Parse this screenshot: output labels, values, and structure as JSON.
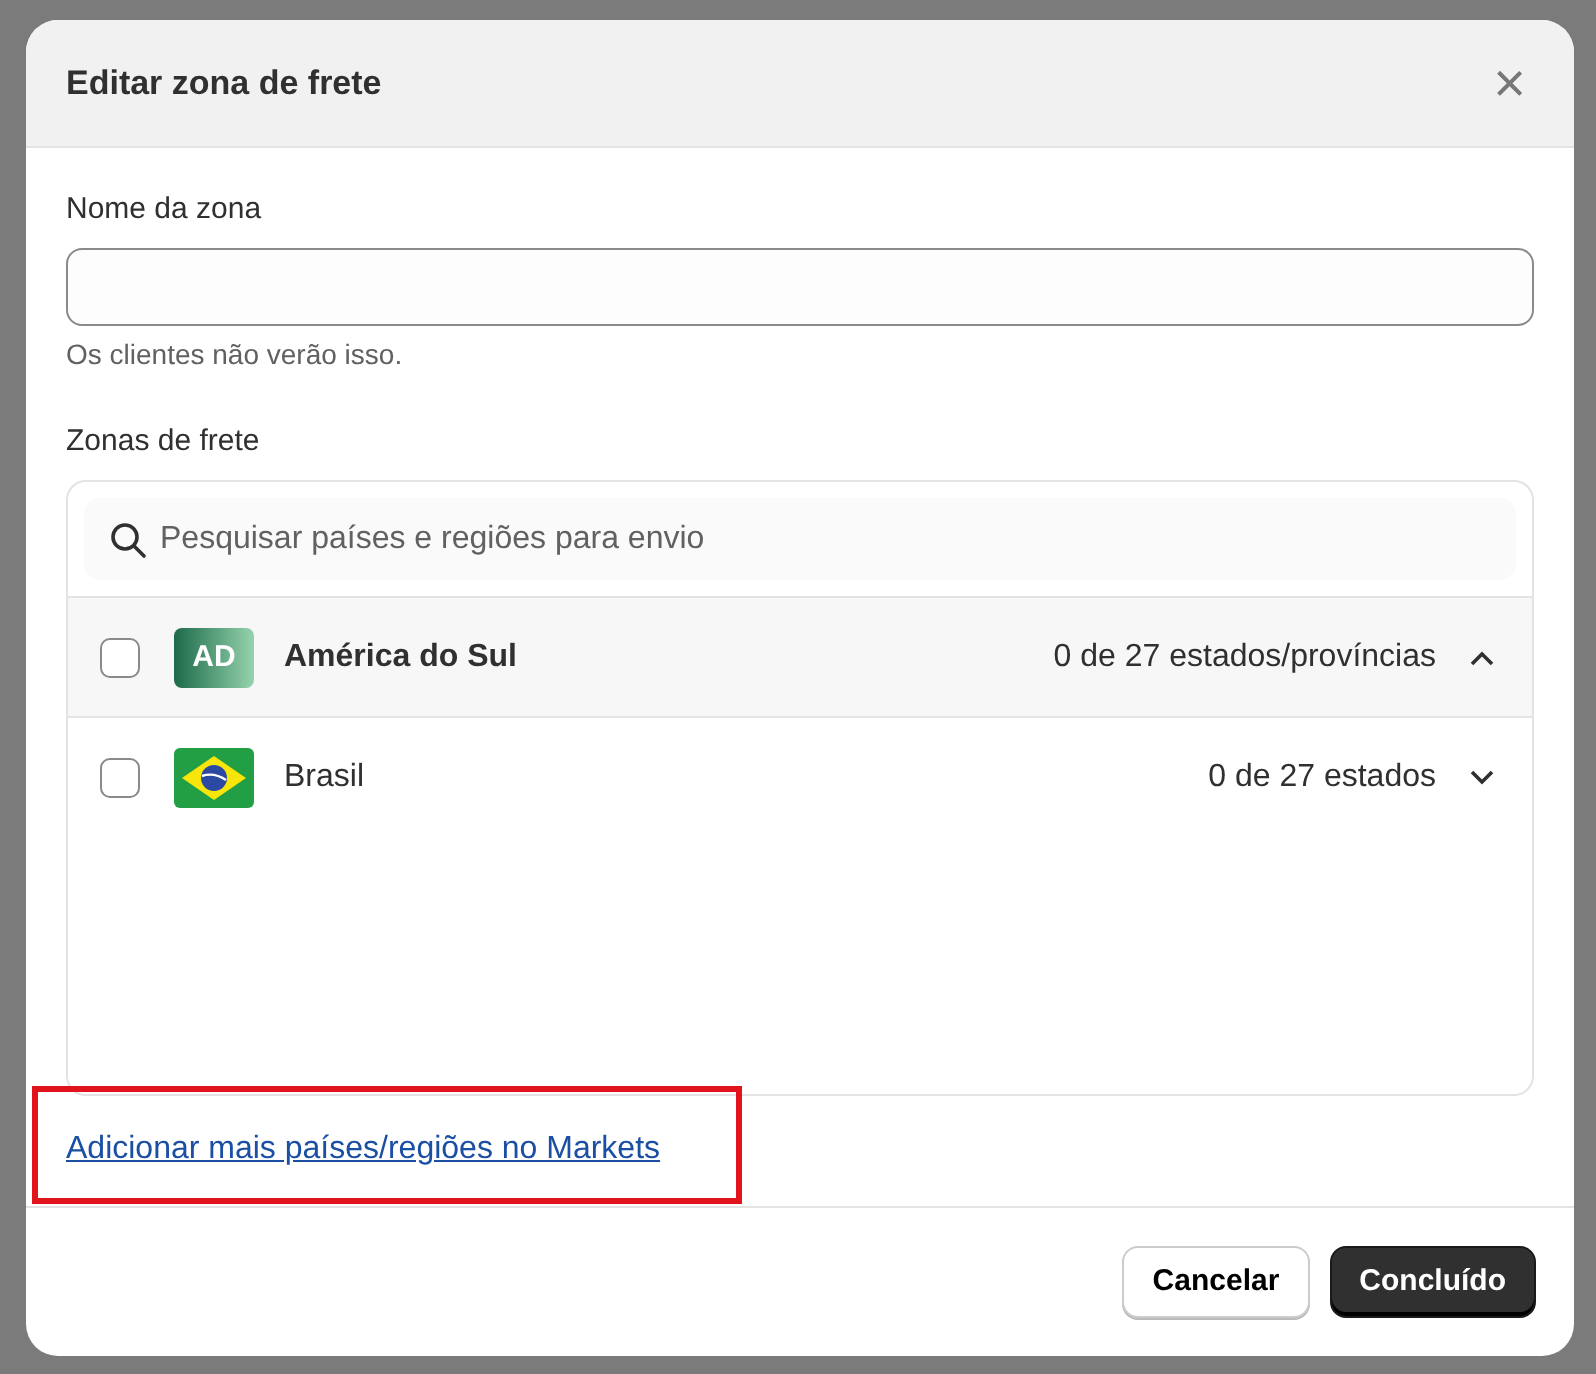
{
  "dialog": {
    "title": "Editar zona de frete",
    "close_label": "×"
  },
  "zone_name": {
    "label": "Nome da zona",
    "help": "Os clientes não verão isso."
  },
  "zones": {
    "label": "Zonas de frete",
    "search": {
      "placeholder": "Pesquisar países e regiões para envio"
    },
    "rows": [
      {
        "kind": "region",
        "badge": "AD",
        "name": "América do Sul",
        "count": "0 de 27 estados/províncias",
        "checked": false,
        "expanded": true
      },
      {
        "kind": "country",
        "name": "Brasil",
        "count": "0 de 27 estados",
        "checked": false,
        "expanded": false
      }
    ]
  },
  "link": {
    "text": "Adicionar mais países/regiões no Markets",
    "highlighted": true
  },
  "buttons": [
    {
      "label": "Cancelar",
      "kind": "secondary"
    },
    {
      "label": "Concluído",
      "kind": "primary"
    }
  ]
}
